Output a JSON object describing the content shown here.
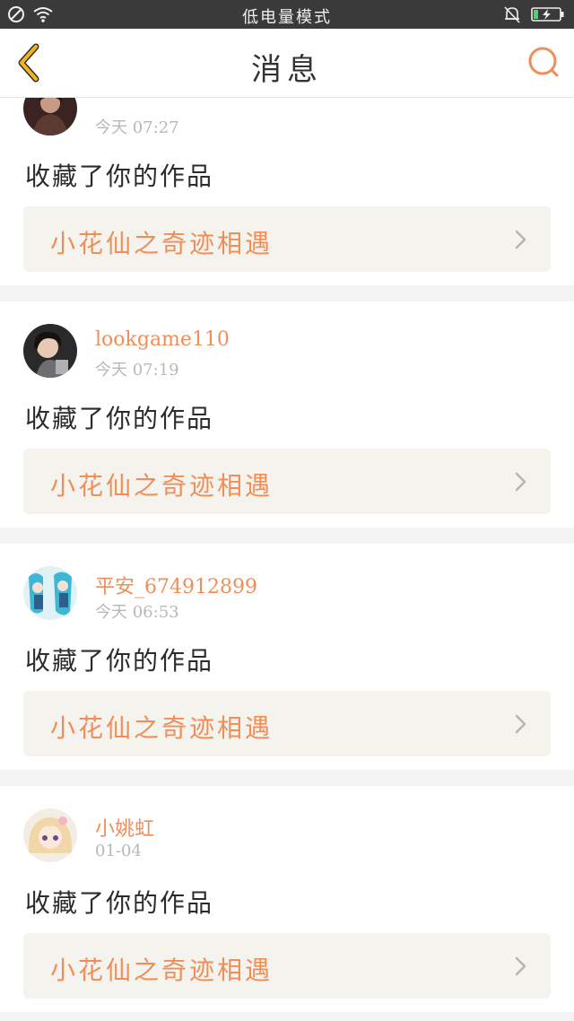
{
  "status_bar": {
    "center_text": "低电量模式",
    "icons": [
      "do-not-disturb-icon",
      "wifi-icon",
      "bell-muted-icon",
      "battery-charging-icon"
    ]
  },
  "header": {
    "title": "消息",
    "back_icon": "chevron-left-icon",
    "search_icon": "search-icon"
  },
  "notifications": [
    {
      "username": "",
      "time": "今天 07:27",
      "action": "收藏了你的作品",
      "work_title": "小花仙之奇迹相遇"
    },
    {
      "username": "lookgame110",
      "time": "今天 07:19",
      "action": "收藏了你的作品",
      "work_title": "小花仙之奇迹相遇"
    },
    {
      "username": "平安_674912899",
      "time": "今天 06:53",
      "action": "收藏了你的作品",
      "work_title": "小花仙之奇迹相遇"
    },
    {
      "username": "小姚虹",
      "time": "01-04",
      "action": "收藏了你的作品",
      "work_title": "小花仙之奇迹相遇"
    }
  ],
  "colors": {
    "accent": "#f08e58",
    "back_icon": "#f2b51f",
    "status_bar_bg": "#3a3a3a"
  }
}
